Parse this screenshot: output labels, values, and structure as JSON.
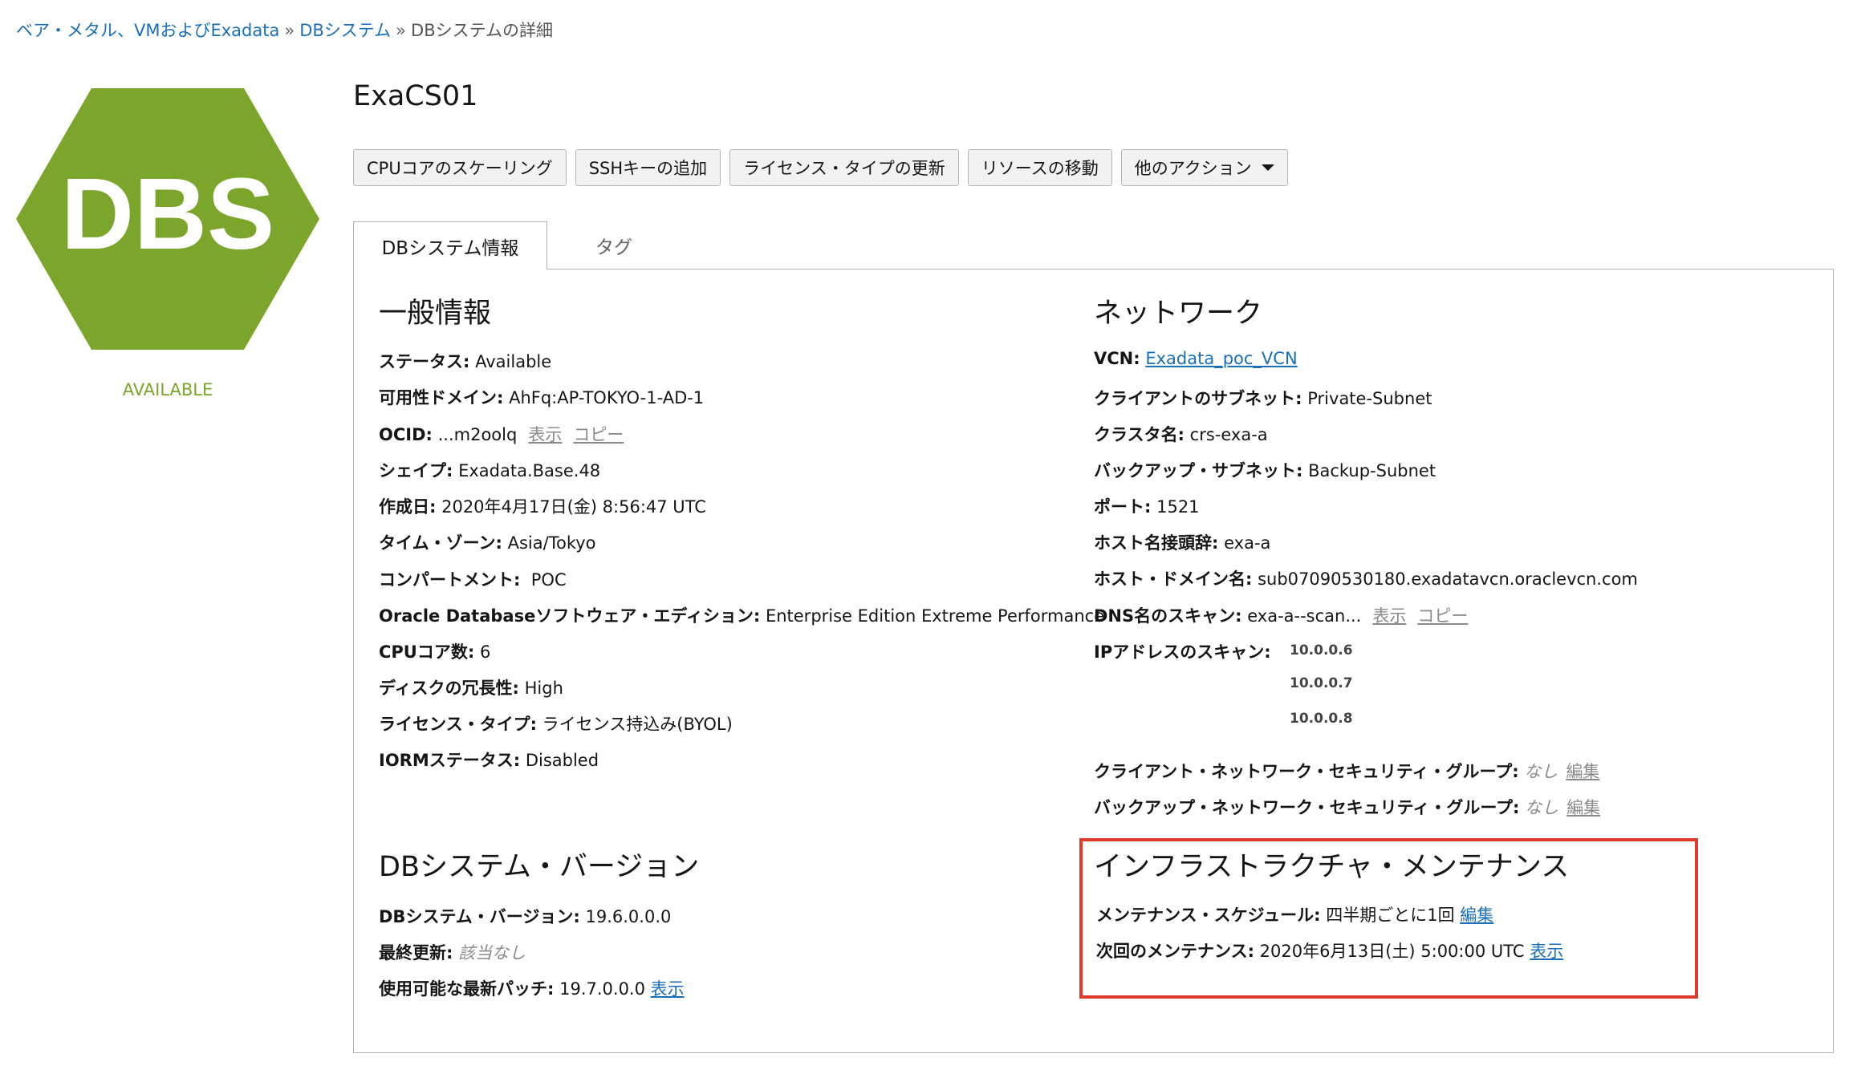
{
  "breadcrumb": {
    "items": [
      "ベア・メタル、VMおよびExadata",
      "DBシステム"
    ],
    "separator": "»",
    "current": "DBシステムの詳細"
  },
  "logo": {
    "text": "DBS",
    "color": "#7ca52b"
  },
  "status": {
    "text": "AVAILABLE",
    "color": "#7ca52b"
  },
  "page_title": "ExaCS01",
  "actions": [
    "CPUコアのスケーリング",
    "SSHキーの追加",
    "ライセンス・タイプの更新",
    "リソースの移動",
    "他のアクション"
  ],
  "tabs": {
    "active": "DBシステム情報",
    "inactive": "タグ"
  },
  "general": {
    "title": "一般情報",
    "status_label": "ステータス:",
    "status_value": "Available",
    "ad_label": "可用性ドメイン:",
    "ad_value": "AhFq:AP-TOKYO-1-AD-1",
    "ocid_label": "OCID:",
    "ocid_value": "...m2oolq",
    "ocid_show": "表示",
    "ocid_copy": "コピー",
    "shape_label": "シェイプ:",
    "shape_value": "Exadata.Base.48",
    "created_label": "作成日:",
    "created_value": "2020年4月17日(金) 8:56:47 UTC",
    "tz_label": "タイム・ゾーン:",
    "tz_value": "Asia/Tokyo",
    "compartment_label": "コンパートメント:",
    "compartment_value": "POC",
    "edition_label": "Oracle Databaseソフトウェア・エディション:",
    "edition_value": "Enterprise Edition Extreme Performance",
    "cpu_label": "CPUコア数:",
    "cpu_value": "6",
    "redundancy_label": "ディスクの冗長性:",
    "redundancy_value": "High",
    "license_label": "ライセンス・タイプ:",
    "license_value": "ライセンス持込み(BYOL)",
    "iorm_label": "IORMステータス:",
    "iorm_value": "Disabled"
  },
  "network": {
    "title": "ネットワーク",
    "vcn_label": "VCN:",
    "vcn_value": "Exadata_poc_VCN",
    "client_subnet_label": "クライアントのサブネット:",
    "client_subnet_value": "Private-Subnet",
    "cluster_label": "クラスタ名:",
    "cluster_value": "crs-exa-a",
    "backup_subnet_label": "バックアップ・サブネット:",
    "backup_subnet_value": "Backup-Subnet",
    "port_label": "ポート:",
    "port_value": "1521",
    "host_prefix_label": "ホスト名接頭辞:",
    "host_prefix_value": "exa-a",
    "host_domain_label": "ホスト・ドメイン名:",
    "host_domain_value": "sub07090530180.exadatavcn.oraclevcn.com",
    "dns_scan_label": "DNS名のスキャン:",
    "dns_scan_value": "exa-a--scan...",
    "dns_show": "表示",
    "dns_copy": "コピー",
    "ip_scan_label": "IPアドレスのスキャン:",
    "ip_scan_values": [
      "10.0.0.6",
      "10.0.0.7",
      "10.0.0.8"
    ],
    "client_nsg_label": "クライアント・ネットワーク・セキュリティ・グループ:",
    "client_nsg_value": "なし",
    "client_nsg_edit": "編集",
    "backup_nsg_label": "バックアップ・ネットワーク・セキュリティ・グループ:",
    "backup_nsg_value": "なし",
    "backup_nsg_edit": "編集"
  },
  "version": {
    "title": "DBシステム・バージョン",
    "version_label": "DBシステム・バージョン:",
    "version_value": "19.6.0.0.0",
    "last_update_label": "最終更新:",
    "last_update_value": "該当なし",
    "latest_patch_label": "使用可能な最新パッチ:",
    "latest_patch_value": "19.7.0.0.0",
    "latest_patch_show": "表示"
  },
  "maintenance": {
    "title": "インフラストラクチャ・メンテナンス",
    "schedule_label": "メンテナンス・スケジュール:",
    "schedule_value": "四半期ごとに1回",
    "schedule_edit": "編集",
    "next_label": "次回のメンテナンス:",
    "next_value": "2020年6月13日(土) 5:00:00 UTC",
    "next_show": "表示",
    "highlight_color": "#e03a2a"
  }
}
